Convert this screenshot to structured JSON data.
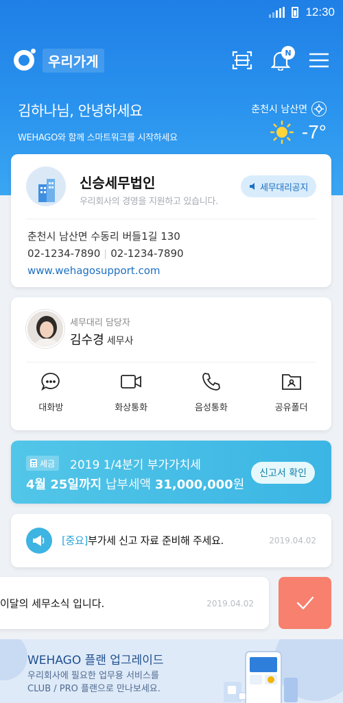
{
  "status_bar": {
    "time": "12:30"
  },
  "header": {
    "title": "우리가게",
    "notification_badge": "N",
    "icons": [
      "app-logo-icon",
      "qr-scan-icon",
      "bell-icon",
      "menu-icon"
    ]
  },
  "greeting": {
    "title": "김하나님, 안녕하세요",
    "subtitle": "WEHAGO와 함께 스마트워크를 시작하세요"
  },
  "weather": {
    "location": "춘천시 남산면",
    "temperature": "-7°",
    "condition_icon": "sun-icon"
  },
  "office": {
    "name": "신승세무법인",
    "description": "우리회사의 경영을 지원하고 있습니다.",
    "notice_button": "세무대리공지",
    "address": "춘천시 남산면 수동리 버들1길 130",
    "phone1": "02-1234-7890",
    "phone2": "02-1234-7890",
    "website": "www.wehagosupport.com"
  },
  "manager": {
    "role": "세무대리 담당자",
    "name": "김수경",
    "title": "세무사",
    "actions": [
      {
        "label": "대화방",
        "icon": "chat-icon"
      },
      {
        "label": "화상통화",
        "icon": "video-call-icon"
      },
      {
        "label": "음성통화",
        "icon": "phone-icon"
      },
      {
        "label": "공유폴더",
        "icon": "shared-folder-icon"
      }
    ]
  },
  "tax": {
    "tag": "세금",
    "title": "2019 1/4분기 부가가치세",
    "due": "4월 25일까지",
    "amount_label": "납부세액",
    "amount": "31,000,000",
    "unit": "원",
    "button": "신고서 확인"
  },
  "alert": {
    "tag": "[중요]",
    "text": "부가세 신고 자료 준비해 주세요.",
    "date": "2019.04.02"
  },
  "news": {
    "text": "이달의 세무소식 입니다.",
    "date": "2019.04.02"
  },
  "banner": {
    "title": "WEHAGO 플랜 업그레이드",
    "line1": "우리회사에 필요한 업무용 서비스를",
    "line2": "CLUB / PRO 플랜으로 만나보세요."
  },
  "colors": {
    "primary": "#1f7fe6",
    "tax_card": "#3bb5e4",
    "confirm_swipe": "#f7806e",
    "link": "#1d6fc2"
  }
}
